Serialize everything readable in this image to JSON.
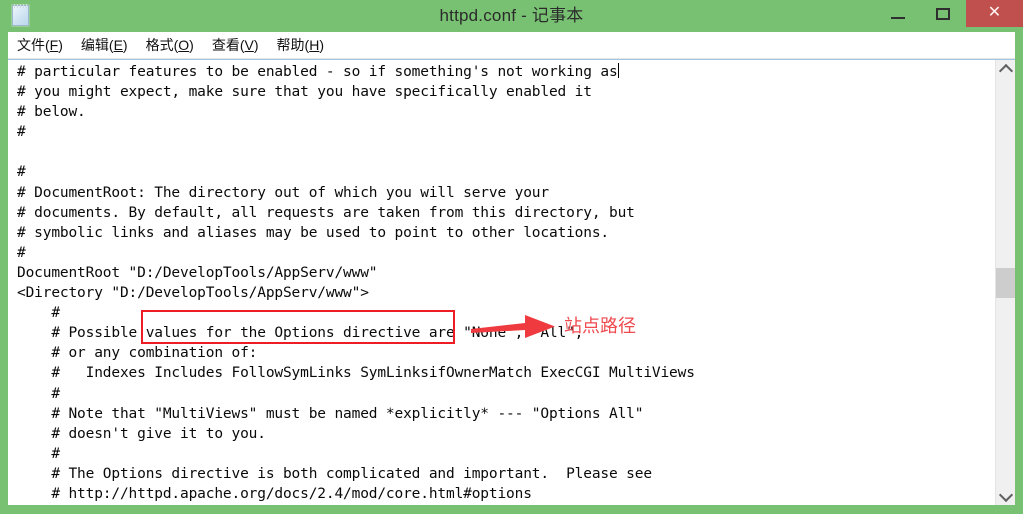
{
  "window": {
    "title": "httpd.conf - 记事本",
    "icon": "notepad-icon",
    "frame_color": "#78c172",
    "close_color": "#c0504d"
  },
  "titlebar_buttons": {
    "minimize_label": "—",
    "maximize_label": "□",
    "close_label": "✕"
  },
  "menubar": {
    "items": [
      {
        "label": "文件",
        "accel": "F"
      },
      {
        "label": "编辑",
        "accel": "E"
      },
      {
        "label": "格式",
        "accel": "O"
      },
      {
        "label": "查看",
        "accel": "V"
      },
      {
        "label": "帮助",
        "accel": "H"
      }
    ]
  },
  "editor": {
    "content": "# particular features to be enabled - so if something's not working as\n# you might expect, make sure that you have specifically enabled it\n# below.\n#\n\n#\n# DocumentRoot: The directory out of which you will serve your\n# documents. By default, all requests are taken from this directory, but\n# symbolic links and aliases may be used to point to other locations.\n#\nDocumentRoot \"D:/DevelopTools/AppServ/www\"\n<Directory \"D:/DevelopTools/AppServ/www\">\n    #\n    # Possible values for the Options directive are \"None\", \"All\",\n    # or any combination of:\n    #   Indexes Includes FollowSymLinks SymLinksifOwnerMatch ExecCGI MultiViews\n    #\n    # Note that \"MultiViews\" must be named *explicitly* --- \"Options All\"\n    # doesn't give it to you.\n    #\n    # The Options directive is both complicated and important.  Please see\n    # http://httpd.apache.org/docs/2.4/mod/core.html#options",
    "caret_line": 1,
    "document_root_value": "D:/DevelopTools/AppServ/www"
  },
  "scrollbar": {
    "up_arrow": "chevron-up",
    "down_arrow": "chevron-down",
    "thumb_position_percent": 47
  },
  "annotation": {
    "label": "站点路径",
    "color": "#ee1c25",
    "label_color": "#ef4b50",
    "highlights": "D:/DevelopTools/AppServ/www"
  }
}
